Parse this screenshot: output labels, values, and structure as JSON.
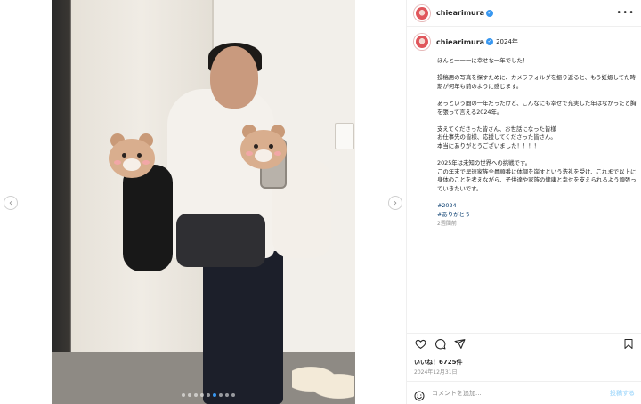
{
  "account": {
    "username": "chiearimura",
    "verified": true
  },
  "media": {
    "slide_count": 9,
    "active_slide": 6
  },
  "caption": {
    "year_tag": "2024年",
    "paragraphs": [
      "ほんと一一一に幸せな一年でした！",
      "投稿用の写真を探すために、カメラフォルダを振り返ると、もう妊娠してた時期が何年も前のように感じます。",
      "あっという間の一年だったけど、こんなにも幸せで充実した年はなかったと胸を張って言える2024年。",
      "支えてくださった皆さん、お世話になった皆様\nお仕事先の皆様、応援してくださった皆さん。\n本当にありがとうございました！！！！",
      "2025年は未知の世界への挑戦です。\nこの年末で早速家族全員順番に体調を崩すという洗礼を受け、これまで以上に身体のことを考えながら、子供達や家族の健康と幸せを支えられるよう頑張っていきたいです。"
    ],
    "hashtags": [
      "#2024",
      "#ありがとう"
    ],
    "time_ago": "2週間前"
  },
  "stats": {
    "likes_text": "いいね！6725件",
    "date": "2024年12月31日"
  },
  "comment": {
    "placeholder": "コメントを追加...",
    "post_label": "投稿する"
  },
  "colors": {
    "accent": "#3897f0",
    "link": "#00376b",
    "muted": "#8e8e8e"
  }
}
